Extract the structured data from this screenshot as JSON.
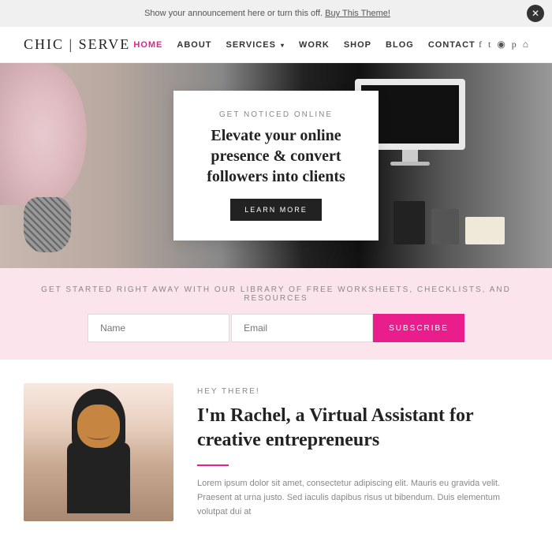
{
  "announcement": {
    "text": "Show your announcement here or turn this off.",
    "link_text": "Buy This Theme!",
    "icon": "✕"
  },
  "logo": {
    "part1": "CHIC",
    "separator": " | ",
    "part2": "SERVE"
  },
  "nav": {
    "items": [
      {
        "label": "HOME",
        "active": true
      },
      {
        "label": "ABOUT",
        "active": false
      },
      {
        "label": "SERVICES",
        "active": false,
        "has_arrow": true
      },
      {
        "label": "WORK",
        "active": false
      },
      {
        "label": "SHOP",
        "active": false
      },
      {
        "label": "BLOG",
        "active": false
      },
      {
        "label": "CONTACT",
        "active": false
      }
    ]
  },
  "social": {
    "icons": [
      "f",
      "t",
      "i",
      "p",
      "a"
    ]
  },
  "hero": {
    "card": {
      "subtitle": "GET NOTICED ONLINE",
      "title": "Elevate your online presence & convert followers into clients",
      "cta_label": "LEARN MORE"
    }
  },
  "subscribe": {
    "label": "GET STARTED RIGHT AWAY WITH OUR LIBRARY OF FREE WORKSHEETS, CHECKLISTS, AND RESOURCES",
    "name_placeholder": "Name",
    "email_placeholder": "Email",
    "button_label": "SUBSCRIBE"
  },
  "about": {
    "subtitle": "HEY THERE!",
    "title": "I'm Rachel, a Virtual Assistant for creative entrepreneurs",
    "body": "Lorem ipsum dolor sit amet, consectetur adipiscing elit. Mauris eu gravida velit. Praesent at urna justo. Sed iaculis dapibus risus ut bibendum. Duis elementum volutpat dui at"
  },
  "colors": {
    "pink": "#e91e8c",
    "dark": "#222222",
    "light_pink_bg": "#fce4ec",
    "text_gray": "#888888"
  }
}
